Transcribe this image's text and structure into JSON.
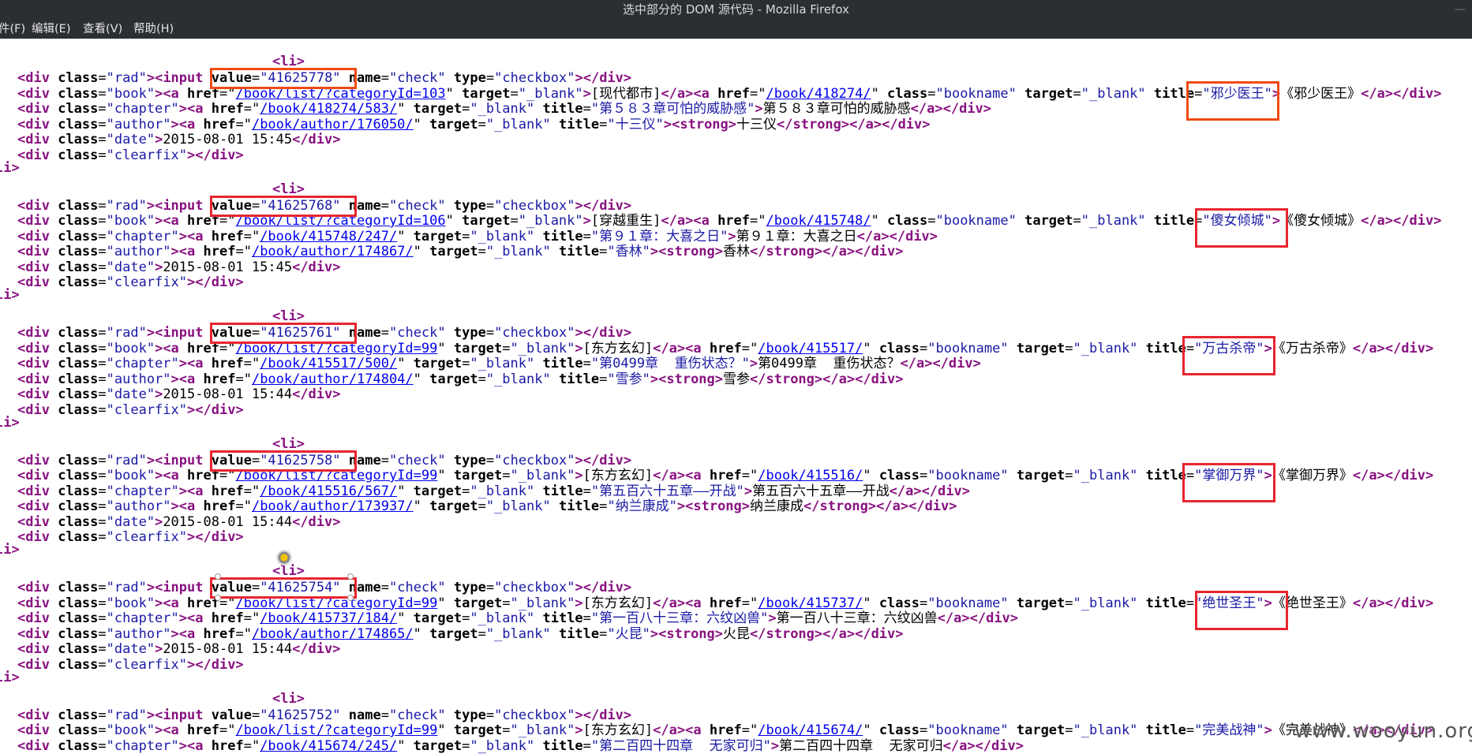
{
  "window": {
    "title": "选中部分的 DOM 源代码 - Mozilla Firefox"
  },
  "menu": {
    "items": [
      {
        "label": "件(F)"
      },
      {
        "label": "编辑(E)"
      },
      {
        "label": "查看(V)"
      },
      {
        "label": "帮助(H)"
      }
    ]
  },
  "source": {
    "li_open": "<li>",
    "li_close": "li>",
    "records": [
      {
        "value": "41625778",
        "category_href": "/book/list/?categoryId=103",
        "category": "现代都市",
        "book_href": "/book/418274/",
        "book_title": "邪少医王",
        "chapter_href": "/book/418274/583/",
        "chapter_title": "第５８３章可怕的威胁感",
        "author_href": "/book/author/176050/",
        "author": "十三仪",
        "date": "2015-08-01 15:45"
      },
      {
        "value": "41625768",
        "category_href": "/book/list/?categoryId=106",
        "category": "穿越重生",
        "book_href": "/book/415748/",
        "book_title": "傻女倾城",
        "chapter_href": "/book/415748/247/",
        "chapter_title": "第９１章：大喜之日",
        "author_href": "/book/author/174867/",
        "author": "香林",
        "date": "2015-08-01 15:45"
      },
      {
        "value": "41625761",
        "category_href": "/book/list/?categoryId=99",
        "category": "东方玄幻",
        "book_href": "/book/415517/",
        "book_title": "万古杀帝",
        "chapter_href": "/book/415517/500/",
        "chapter_title": "第0499章  重伤状态？",
        "author_href": "/book/author/174804/",
        "author": "雪参",
        "date": "2015-08-01 15:44"
      },
      {
        "value": "41625758",
        "category_href": "/book/list/?categoryId=99",
        "category": "东方玄幻",
        "book_href": "/book/415516/",
        "book_title": "掌御万界",
        "chapter_href": "/book/415516/567/",
        "chapter_title": "第五百六十五章——开战",
        "author_href": "/book/author/173937/",
        "author": "纳兰康成",
        "date": "2015-08-01 15:44"
      },
      {
        "value": "41625754",
        "category_href": "/book/list/?categoryId=99",
        "category": "东方玄幻",
        "book_href": "/book/415737/",
        "book_title": "绝世圣王",
        "chapter_href": "/book/415737/184/",
        "chapter_title": "第一百八十三章：六纹凶兽",
        "author_href": "/book/author/174865/",
        "author": "火昆",
        "date": "2015-08-01 15:44"
      },
      {
        "value": "41625752",
        "category_href": "/book/list/?categoryId=99",
        "category": "东方玄幻",
        "book_href": "/book/415674/",
        "book_title": "完美战神",
        "chapter_href": "/book/415674/245/",
        "chapter_title": "第二百四十四章  无家可归",
        "author_href": "",
        "author": "",
        "date": ""
      }
    ]
  },
  "watermark": "www.wooyun.org",
  "colors": {
    "tag": "#881280",
    "attr_value": "#1a1aa6",
    "link": "#0000ee",
    "highlight": "#e8252f"
  }
}
